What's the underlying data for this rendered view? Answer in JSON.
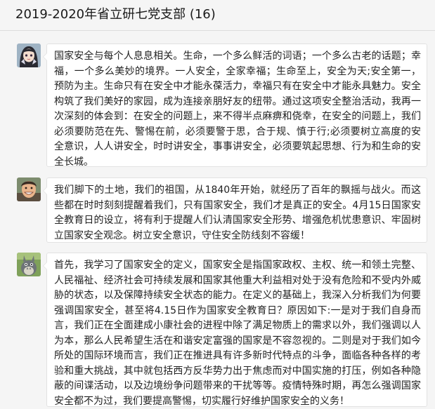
{
  "header": {
    "title": "2019-2020年省立研七党支部 (16)"
  },
  "messages": [
    {
      "avatar": "anime-girl-avatar",
      "text": "国家安全与每个人息息相关。生命，一个多么鲜活的词语；一个多么古老的话题；幸福，一个多么美妙的境界。一人安全，全家幸福；生命至上，安全为天;安全第一，预防为主。生命只有在安全中才能永葆活力，幸福只有在安全中才能永具魅力。安全构筑了我们美好的家园，成为连接亲朋好友的纽带。通过这项安全整治活动，我再一次深刻的体会到：在安全的问题上，来不得半点麻痹和侥幸，在安全的问题上，我们必须要防范在先、警惕在前，必须要警于思，合于规、慎于行;必须要树立高度的安全意识，人人讲安全，时时讲安全，事事讲安全，必须要筑起思想、行为和生命的安全长城。"
    },
    {
      "avatar": "smiling-man-avatar",
      "text": "我们脚下的土地，我们的祖国，从1840年开始，就经历了百年的飘摇与战火。而这些都在时时刻刻提醒着我们，只有国家安全，我们才是真正的安全。4月15日国家安全教育日的设立，将有利于提醒人们认清国家安全形势、增强危机忧患意识、牢固树立国家安全观念。树立安全意识，守住安全防线刻不容缓！"
    },
    {
      "avatar": "totoro-avatar",
      "text": "首先，我学习了国家安全的定义，国家安全是指国家政权、主权、统一和领土完整、人民福祉、经济社会可持续发展和国家其他重大利益相对处于没有危险和不受内外威胁的状态，以及保障持续安全状态的能力。在定义的基础上，我深入分析我们为何要强调国家安全，甚至将4.15日作为国家安全教育日？原因如下:一是对于我们自身而言，我们正在全面建成小康社会的进程中除了满足物质上的需求以外，我们强调以人为本，那么人民希望生活在和谐安定富强的国家是不容忽视的。二则是对于我们如今所处的国际环境而言，我们正在推进具有许多新时代特点的斗争，面临各种各样的考验和重大挑战，其中就包括西方反华势力出于焦虑而对中国实施的打压，例如各种隐蔽的间谍活动，以及边境纷争问题带来的干扰等等。疫情特殊时期，再怎么强调国家安全都不为过，我们要提高警惕，切实履行好维护国家安全的义务！"
    }
  ]
}
